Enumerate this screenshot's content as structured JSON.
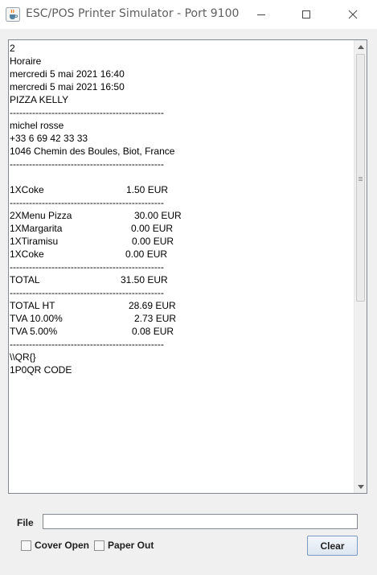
{
  "window": {
    "title": "ESC/POS Printer Simulator - Port 9100",
    "app_icon": "java-cup-icon"
  },
  "titlebar_buttons": {
    "minimize": "minimize-icon",
    "maximize": "maximize-icon",
    "close": "close-icon"
  },
  "receipt": {
    "lines": [
      {
        "text": "2"
      },
      {
        "text": "Horaire"
      },
      {
        "text": "mercredi 5 mai 2021 16:40"
      },
      {
        "text": "mercredi 5 mai 2021 16:50"
      },
      {
        "text": "PIZZA KELLY"
      },
      {
        "text": "------------------------------------------------"
      },
      {
        "text": "michel rosse"
      },
      {
        "text": "+33 6 69 42 33 33"
      },
      {
        "text": "1046 Chemin des Boules, Biot, France"
      },
      {
        "text": "------------------------------------------------"
      },
      {
        "text": ""
      },
      {
        "text": "1XCoke",
        "amount": "1.50 EUR"
      },
      {
        "text": "------------------------------------------------"
      },
      {
        "text": "2XMenu Pizza",
        "amount": "30.00 EUR"
      },
      {
        "text": "1XMargarita",
        "amount": "0.00 EUR"
      },
      {
        "text": "1XTiramisu",
        "amount": "0.00 EUR"
      },
      {
        "text": "1XCoke",
        "amount": "0.00 EUR"
      },
      {
        "text": "------------------------------------------------"
      },
      {
        "text": "TOTAL",
        "amount": "31.50 EUR"
      },
      {
        "text": "------------------------------------------------"
      },
      {
        "text": "TOTAL HT",
        "amount": "28.69 EUR"
      },
      {
        "text": "TVA 10.00%",
        "amount": "2.73 EUR"
      },
      {
        "text": "TVA 5.00%",
        "amount": "0.08 EUR"
      },
      {
        "text": "------------------------------------------------"
      },
      {
        "text": "\\\\QR{}"
      },
      {
        "text": "1P0QR CODE"
      }
    ]
  },
  "file_row": {
    "label": "File",
    "value": ""
  },
  "checkboxes": {
    "cover_open": {
      "label": "Cover Open",
      "checked": false
    },
    "paper_out": {
      "label": "Paper Out",
      "checked": false
    }
  },
  "buttons": {
    "clear": "Clear"
  }
}
